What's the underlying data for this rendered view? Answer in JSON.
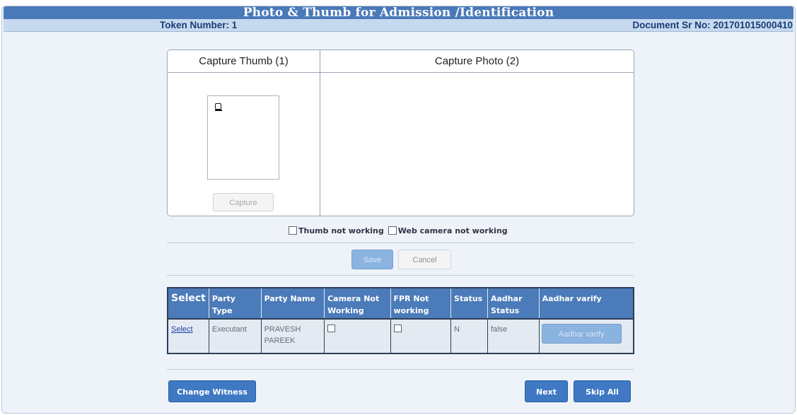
{
  "header": {
    "title": "Photo & Thumb for Admission /Identification",
    "token": "Token Number: 1",
    "document_sr": "Document Sr No: 201701015000410"
  },
  "capture": {
    "thumb_heading": "Capture Thumb (1)",
    "photo_heading": "Capture Photo (2)",
    "capture_button": "Capture"
  },
  "options": {
    "thumb_not_working": "Thumb not working",
    "web_camera_not_working": "Web camera not working"
  },
  "actions": {
    "save": "Save",
    "cancel": "Cancel"
  },
  "table": {
    "headers": [
      "Select",
      "Party Type",
      "Party Name",
      "Camera Not Working",
      "FPR Not working",
      "Status",
      "Aadhar Status",
      "Aadhar varify"
    ],
    "rows": [
      {
        "select": "Select",
        "party_type": "Executant",
        "party_name": "PRAVESH PAREEK",
        "status": "N",
        "aadhar_status": "false",
        "aadhar_button": "Aadhar varify"
      }
    ]
  },
  "footer": {
    "change_witness": "Change Witness",
    "next": "Next",
    "skip_all": "Skip All"
  }
}
